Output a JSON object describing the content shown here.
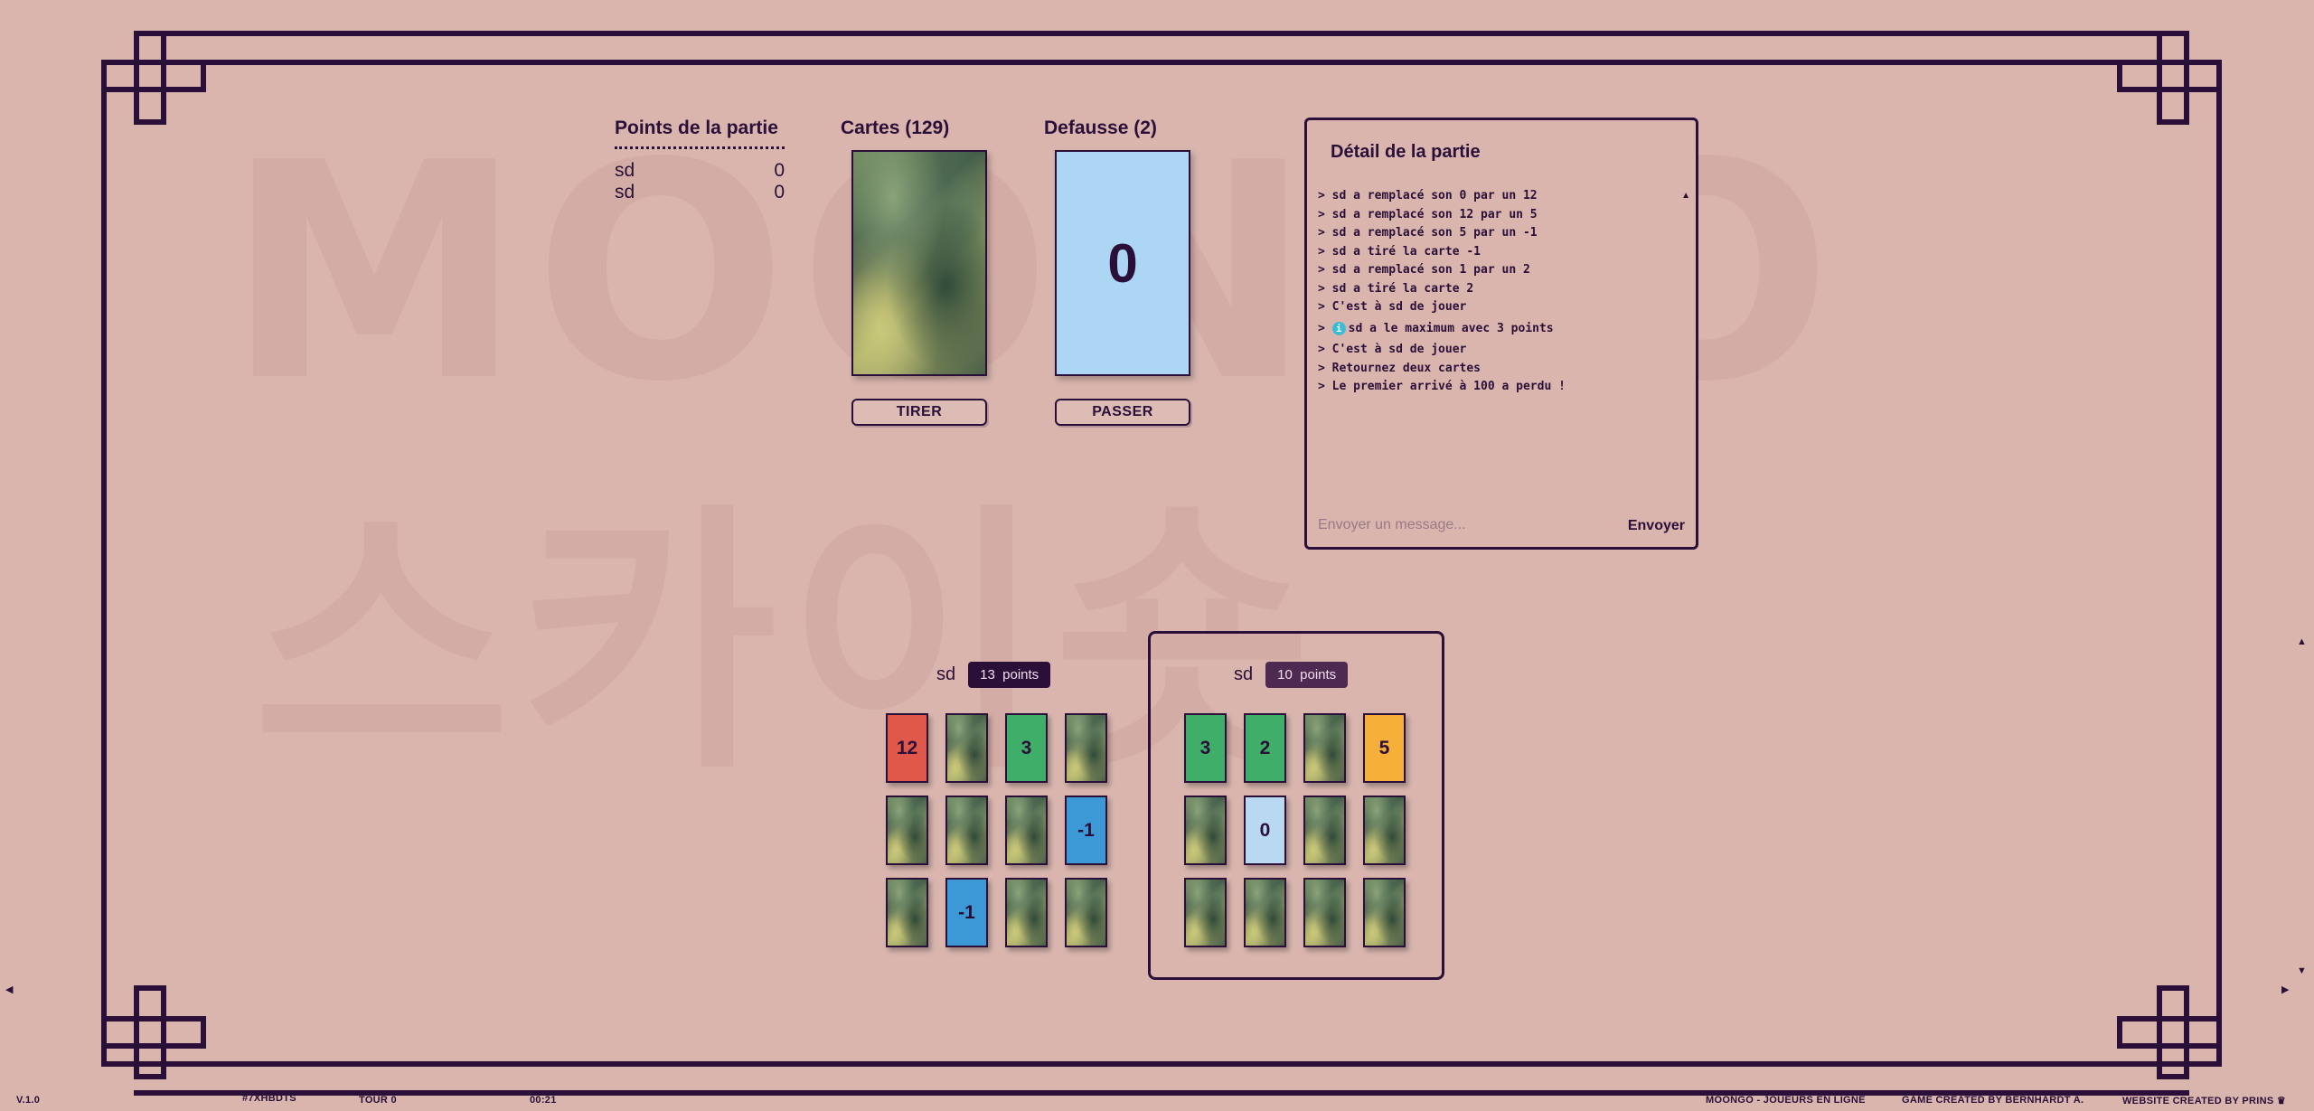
{
  "background_watermark": [
    "MOONGO",
    "스카이숏"
  ],
  "score_panel": {
    "title": "Points de la partie",
    "rows": [
      {
        "name": "sd",
        "score": "0"
      },
      {
        "name": "sd",
        "score": "0"
      }
    ]
  },
  "deck": {
    "title": "Cartes (129)",
    "button": "TIRER"
  },
  "discard": {
    "title": "Defausse (2)",
    "top_card": "0",
    "button": "PASSER"
  },
  "log": {
    "title": "Détail de la partie",
    "lines": [
      "> sd a remplacé son 0 par un 12",
      "> sd a remplacé son 12 par un 5",
      "> sd a remplacé son 5 par un -1",
      "> sd a tiré la carte -1",
      "> sd a remplacé son 1 par un 2",
      "> sd a tiré la carte 2",
      "> C'est à sd de jouer",
      "sd a le maximum avec 3 points",
      "> C'est à sd de jouer",
      "> Retournez deux cartes",
      "> Le premier arrivé à 100 a perdu !"
    ],
    "info_prefix": ">",
    "info_icon_glyph": "i",
    "input_placeholder": "Envoyer un message...",
    "send_label": "Envoyer"
  },
  "player1": {
    "name": "sd",
    "points": "13",
    "points_label": "points",
    "cards": [
      {
        "value": "12",
        "color": "red"
      },
      {
        "value": "",
        "color": "back"
      },
      {
        "value": "3",
        "color": "green"
      },
      {
        "value": "",
        "color": "back"
      },
      {
        "value": "",
        "color": "back"
      },
      {
        "value": "",
        "color": "back"
      },
      {
        "value": "",
        "color": "back"
      },
      {
        "value": "-1",
        "color": "blue"
      },
      {
        "value": "",
        "color": "back"
      },
      {
        "value": "-1",
        "color": "blue"
      },
      {
        "value": "",
        "color": "back"
      },
      {
        "value": "",
        "color": "back"
      }
    ]
  },
  "player2": {
    "name": "sd",
    "points": "10",
    "points_label": "points",
    "cards": [
      {
        "value": "3",
        "color": "green"
      },
      {
        "value": "2",
        "color": "green"
      },
      {
        "value": "",
        "color": "back"
      },
      {
        "value": "5",
        "color": "orange"
      },
      {
        "value": "",
        "color": "back"
      },
      {
        "value": "0",
        "color": "lightblue"
      },
      {
        "value": "",
        "color": "back"
      },
      {
        "value": "",
        "color": "back"
      },
      {
        "value": "",
        "color": "back"
      },
      {
        "value": "",
        "color": "back"
      },
      {
        "value": "",
        "color": "back"
      },
      {
        "value": "",
        "color": "back"
      }
    ]
  },
  "footer": {
    "version": "V.1.0",
    "game_code": "#7XHBDTS",
    "turn": "TOUR 0",
    "timer": "00:21",
    "site_title": "MOONGO - JOUEURS EN LIGNE",
    "game_credit": "GAME CREATED BY BERNHARDT A.",
    "website_credit": "WEBSITE CREATED BY PRINS",
    "crown_icon": "♛"
  },
  "colors": {
    "background": "#d9b5ae",
    "ink": "#2a0f38",
    "red": "#e0584a",
    "green": "#3fae68",
    "blue": "#3d98d6",
    "lightblue": "#b9d8f2",
    "orange": "#f6b03a",
    "discard": "#add6f4"
  },
  "icons": {
    "scroll_up": "▲",
    "arrow_left": "◀",
    "arrow_right": "▶",
    "arrow_up": "▲",
    "arrow_down": "▼"
  }
}
